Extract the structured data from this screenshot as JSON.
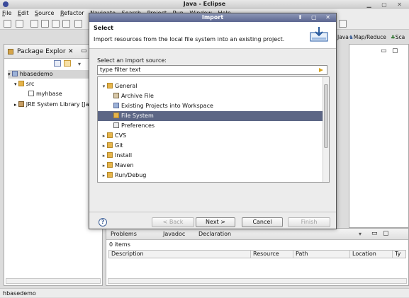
{
  "window": {
    "title": "Java - Eclipse"
  },
  "menu": [
    "File",
    "Edit",
    "Source",
    "Refactor",
    "Navigate",
    "Search",
    "Project",
    "Run",
    "Window",
    "Help"
  ],
  "perspectives": {
    "items": [
      "Java",
      "Map/Reduce",
      "Sca"
    ]
  },
  "package_explorer": {
    "tab_label": "Package Explor",
    "tree": [
      {
        "label": "hbasedemo",
        "icon": "project-icon"
      },
      {
        "label": "src",
        "icon": "source-folder-icon"
      },
      {
        "label": "myhbase",
        "icon": "package-icon"
      },
      {
        "label": "JRE System Library [Ja",
        "icon": "library-icon"
      }
    ]
  },
  "problems": {
    "tabs": [
      "Problems",
      "Javadoc",
      "Declaration"
    ],
    "count": "0 items",
    "columns": [
      "Description",
      "Resource",
      "Path",
      "Location",
      "Ty"
    ]
  },
  "status": {
    "text": "hbasedemo"
  },
  "dialog": {
    "title": "Import",
    "heading": "Select",
    "description": "Import resources from the local file system into an existing project.",
    "source_label": "Select an import source:",
    "filter_value": "type filter text",
    "tree": [
      {
        "label": "General",
        "expanded": true,
        "level": 0
      },
      {
        "label": "Archive File",
        "level": 1
      },
      {
        "label": "Existing Projects into Workspace",
        "level": 1
      },
      {
        "label": "File System",
        "level": 1,
        "selected": true
      },
      {
        "label": "Preferences",
        "level": 1
      },
      {
        "label": "CVS",
        "level": 0
      },
      {
        "label": "Git",
        "level": 0
      },
      {
        "label": "Install",
        "level": 0
      },
      {
        "label": "Maven",
        "level": 0
      },
      {
        "label": "Run/Debug",
        "level": 0
      }
    ],
    "buttons": {
      "back": "< Back",
      "next": "Next >",
      "cancel": "Cancel",
      "finish": "Finish"
    }
  }
}
